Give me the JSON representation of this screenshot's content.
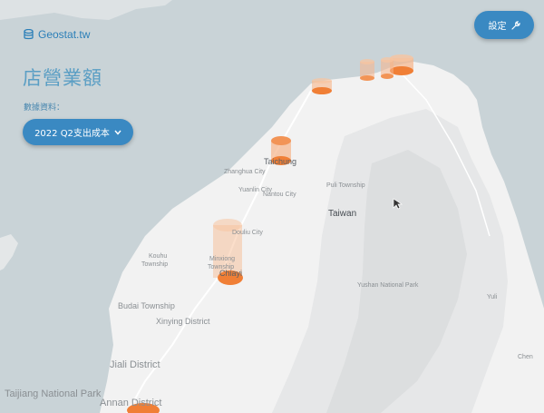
{
  "brand": {
    "name": "Geostat.tw",
    "icon": "database-icon"
  },
  "page": {
    "title": "店營業額"
  },
  "data_source": {
    "label": "數據資料：",
    "selected": "2022 Q2支出成本"
  },
  "settings": {
    "label": "設定",
    "icon": "wrench-icon"
  },
  "colors": {
    "accent": "#3a89c2",
    "water": "#c9d3d7",
    "land": "#f2f2f2",
    "bar": "#f28c4a"
  },
  "map": {
    "labels": {
      "taiwan": "Taiwan",
      "taichung": "Taichung",
      "zhanghua": "Zhanghua City",
      "yuanlin": "Yuanlin City",
      "nantou": "Nantou City",
      "puli": "Puli Township",
      "douliu": "Douliu City",
      "kouhu": "Kouhu",
      "kouhu2": "Township",
      "minxiong": "Minxiong",
      "minxiong2": "Township",
      "chiayi": "Chiayi",
      "budai": "Budai Township",
      "xinying": "Xinying District",
      "jiali": "Jiali District",
      "taijiang": "Taijiang National Park",
      "annan": "Annan District",
      "yushan": "Yushan National Park",
      "yuli": "Yuli",
      "chen": "Chen"
    }
  }
}
